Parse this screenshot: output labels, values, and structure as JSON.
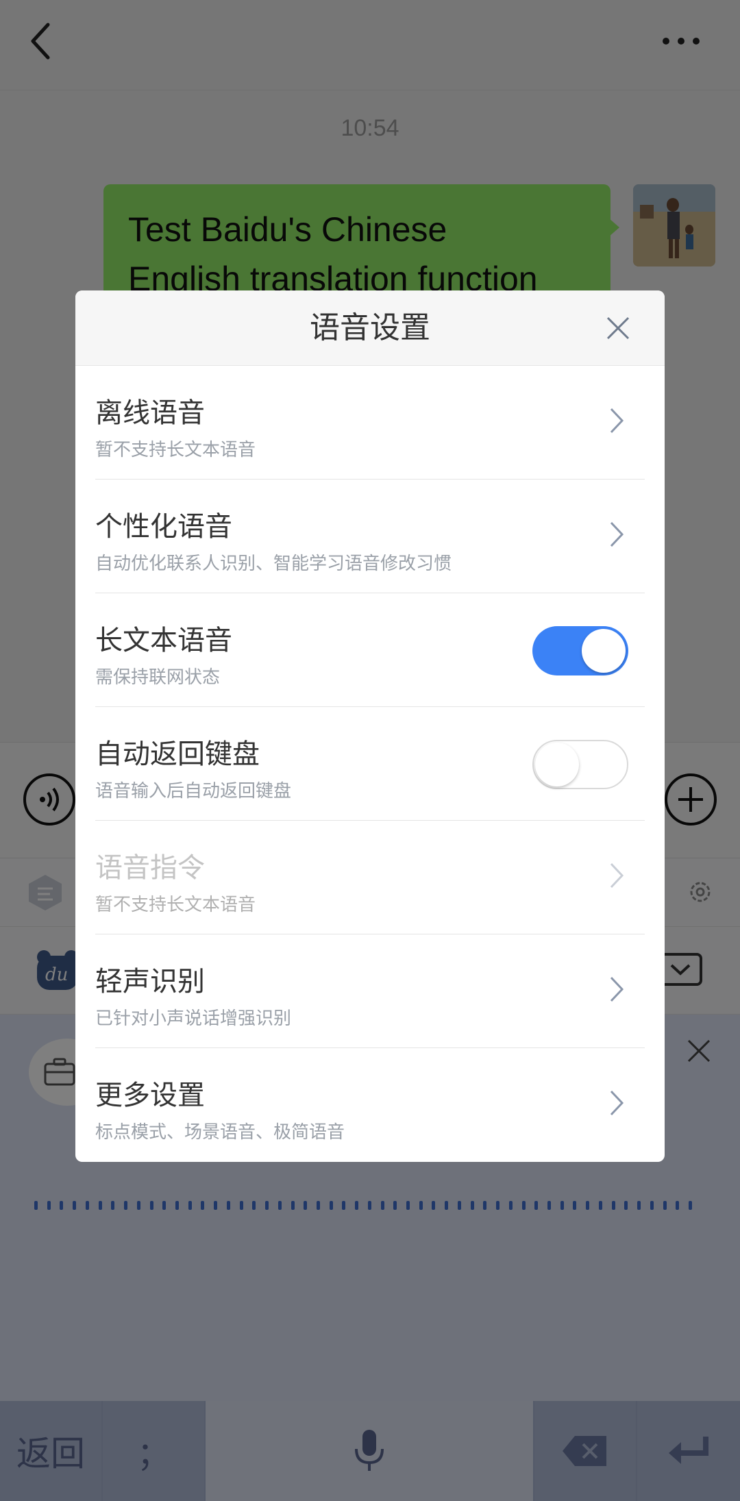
{
  "chat": {
    "timestamp": "10:54",
    "message_line1": "Test Baidu's Chinese",
    "message_line2": "English translation function"
  },
  "keyboard": {
    "return_key": "返回",
    "semicolon_key": "；"
  },
  "dialog": {
    "title": "语音设置",
    "rows": [
      {
        "title": "离线语音",
        "desc": "暂不支持长文本语音",
        "control": "chevron",
        "enabled": true
      },
      {
        "title": "个性化语音",
        "desc": "自动优化联系人识别、智能学习语音修改习惯",
        "control": "chevron",
        "enabled": true
      },
      {
        "title": "长文本语音",
        "desc": "需保持联网状态",
        "control": "toggle",
        "toggle_on": true,
        "enabled": true
      },
      {
        "title": "自动返回键盘",
        "desc": "语音输入后自动返回键盘",
        "control": "toggle",
        "toggle_on": false,
        "enabled": true
      },
      {
        "title": "语音指令",
        "desc": "暂不支持长文本语音",
        "control": "chevron",
        "enabled": false
      },
      {
        "title": "轻声识别",
        "desc": "已针对小声说话增强识别",
        "control": "chevron",
        "enabled": true
      },
      {
        "title": "更多设置",
        "desc": "标点模式、场景语音、极简语音",
        "control": "chevron",
        "enabled": true
      }
    ]
  },
  "colors": {
    "bubble": "#95ec69",
    "toggle_on": "#3b82f6",
    "waveform": "#3f6fd1"
  },
  "icons": [
    "back-icon",
    "more-icon",
    "voice-circle-icon",
    "plus-circle-icon",
    "settings-gear-icon",
    "collapse-keyboard-icon",
    "briefcase-icon",
    "close-icon",
    "microphone-icon",
    "backspace-icon",
    "enter-icon",
    "chevron-right-icon"
  ]
}
